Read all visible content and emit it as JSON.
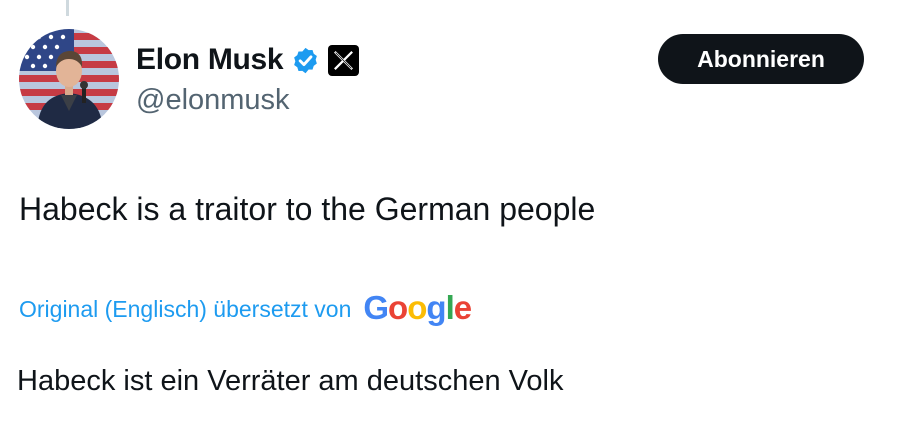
{
  "author": {
    "display_name": "Elon Musk",
    "handle": "@elonmusk",
    "verified_icon": "verified-badge-icon",
    "affiliation_icon": "x-logo-icon"
  },
  "actions": {
    "subscribe_label": "Abonnieren"
  },
  "tweet": {
    "text": "Habeck is a traitor to the German people"
  },
  "translation": {
    "label": "Original (Englisch) übersetzt von",
    "provider_letters": [
      "G",
      "o",
      "o",
      "g",
      "l",
      "e"
    ],
    "provider_colors": [
      "#4285F4",
      "#EA4335",
      "#FBBC05",
      "#4285F4",
      "#34A853",
      "#EA4335"
    ],
    "translated_text": "Habeck ist ein Verräter am deutschen Volk"
  },
  "colors": {
    "text_primary": "#0f1419",
    "text_secondary": "#536471",
    "link_blue": "#1d9bf0",
    "verified_blue": "#1d9bf0",
    "button_dark": "#0f1419"
  }
}
